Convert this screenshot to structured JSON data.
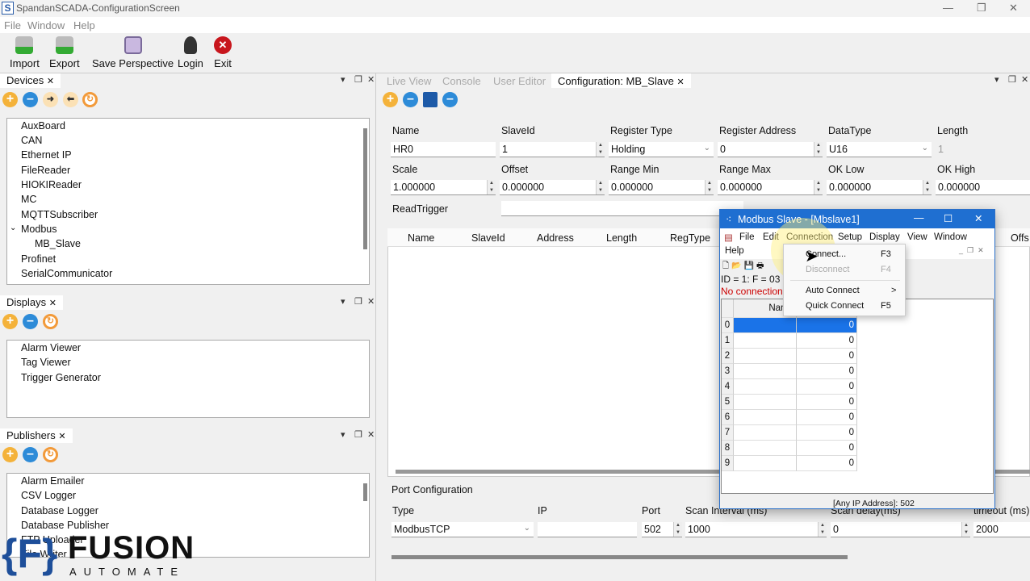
{
  "app": {
    "title": "SpandanSCADA-ConfigurationScreen",
    "logo_letter": "S"
  },
  "menu": [
    "File",
    "Window",
    "Help"
  ],
  "toolbar": [
    {
      "label": "Import",
      "icon": "database-import-icon"
    },
    {
      "label": "Export",
      "icon": "database-export-icon"
    },
    {
      "label": "Save Perspective",
      "icon": "perspective-icon"
    },
    {
      "label": "Login",
      "icon": "user-icon"
    },
    {
      "label": "Exit",
      "icon": "exit-icon"
    }
  ],
  "devices": {
    "title": "Devices",
    "items": [
      "AuxBoard",
      "CAN",
      "Ethernet IP",
      "FileReader",
      "HIOKIReader",
      "MC",
      "MQTTSubscriber",
      "Modbus",
      "MB_Slave",
      "Profinet",
      "SerialCommunicator"
    ]
  },
  "displays": {
    "title": "Displays",
    "items": [
      "Alarm Viewer",
      "Tag Viewer",
      "Trigger Generator"
    ]
  },
  "publishers": {
    "title": "Publishers",
    "items": [
      "Alarm Emailer",
      "CSV Logger",
      "Database Logger",
      "Database Publisher",
      "FTP Uploader",
      "File Writer"
    ]
  },
  "tabs": [
    "Live View",
    "Console",
    "User Editor",
    "Configuration: MB_Slave"
  ],
  "form": {
    "labels1": [
      "Name",
      "SlaveId",
      "Register Type",
      "Register Address",
      "DataType",
      "Length"
    ],
    "values1": [
      "HR0",
      "1",
      "Holding",
      "0",
      "U16",
      "1"
    ],
    "labels2": [
      "Scale",
      "Offset",
      "Range Min",
      "Range Max",
      "OK Low",
      "OK High"
    ],
    "values2": [
      "1.000000",
      "0.000000",
      "0.000000",
      "0.000000",
      "0.000000",
      "0.000000"
    ],
    "read_trigger_label": "ReadTrigger",
    "read_trigger_value": ""
  },
  "table_headers": [
    "Name",
    "SlaveId",
    "Address",
    "Length",
    "RegType",
    "Offs"
  ],
  "port": {
    "title": "Port Configuration",
    "labels": [
      "Type",
      "IP",
      "Port",
      "Scan Interval (ms)",
      "Scan delay(ms)",
      "timeout (ms)"
    ],
    "values": [
      "ModbusTCP",
      "",
      "502",
      "1000",
      "0",
      "2000"
    ]
  },
  "modbus_slave": {
    "title": "Modbus Slave - [Mbslave1]",
    "menu": [
      "File",
      "Edit",
      "Connection",
      "Setup",
      "Display",
      "View",
      "Window",
      "Help"
    ],
    "status1": "ID = 1: F = 03",
    "status2": "No connection",
    "col_header": "Name",
    "rows": [
      {
        "n": "0",
        "v": "0"
      },
      {
        "n": "1",
        "v": "0"
      },
      {
        "n": "2",
        "v": "0"
      },
      {
        "n": "3",
        "v": "0"
      },
      {
        "n": "4",
        "v": "0"
      },
      {
        "n": "5",
        "v": "0"
      },
      {
        "n": "6",
        "v": "0"
      },
      {
        "n": "7",
        "v": "0"
      },
      {
        "n": "8",
        "v": "0"
      },
      {
        "n": "9",
        "v": "0"
      }
    ],
    "statusbar": "[Any IP Address]: 502",
    "context_menu": [
      {
        "label": "Connect...",
        "shortcut": "F3"
      },
      {
        "label": "Disconnect",
        "shortcut": "F4"
      },
      {
        "label": "Auto Connect",
        "shortcut": ">"
      },
      {
        "label": "Quick Connect",
        "shortcut": "F5"
      }
    ]
  },
  "watermark": {
    "brand": "FUSION",
    "sub": "AUTOMATE"
  }
}
